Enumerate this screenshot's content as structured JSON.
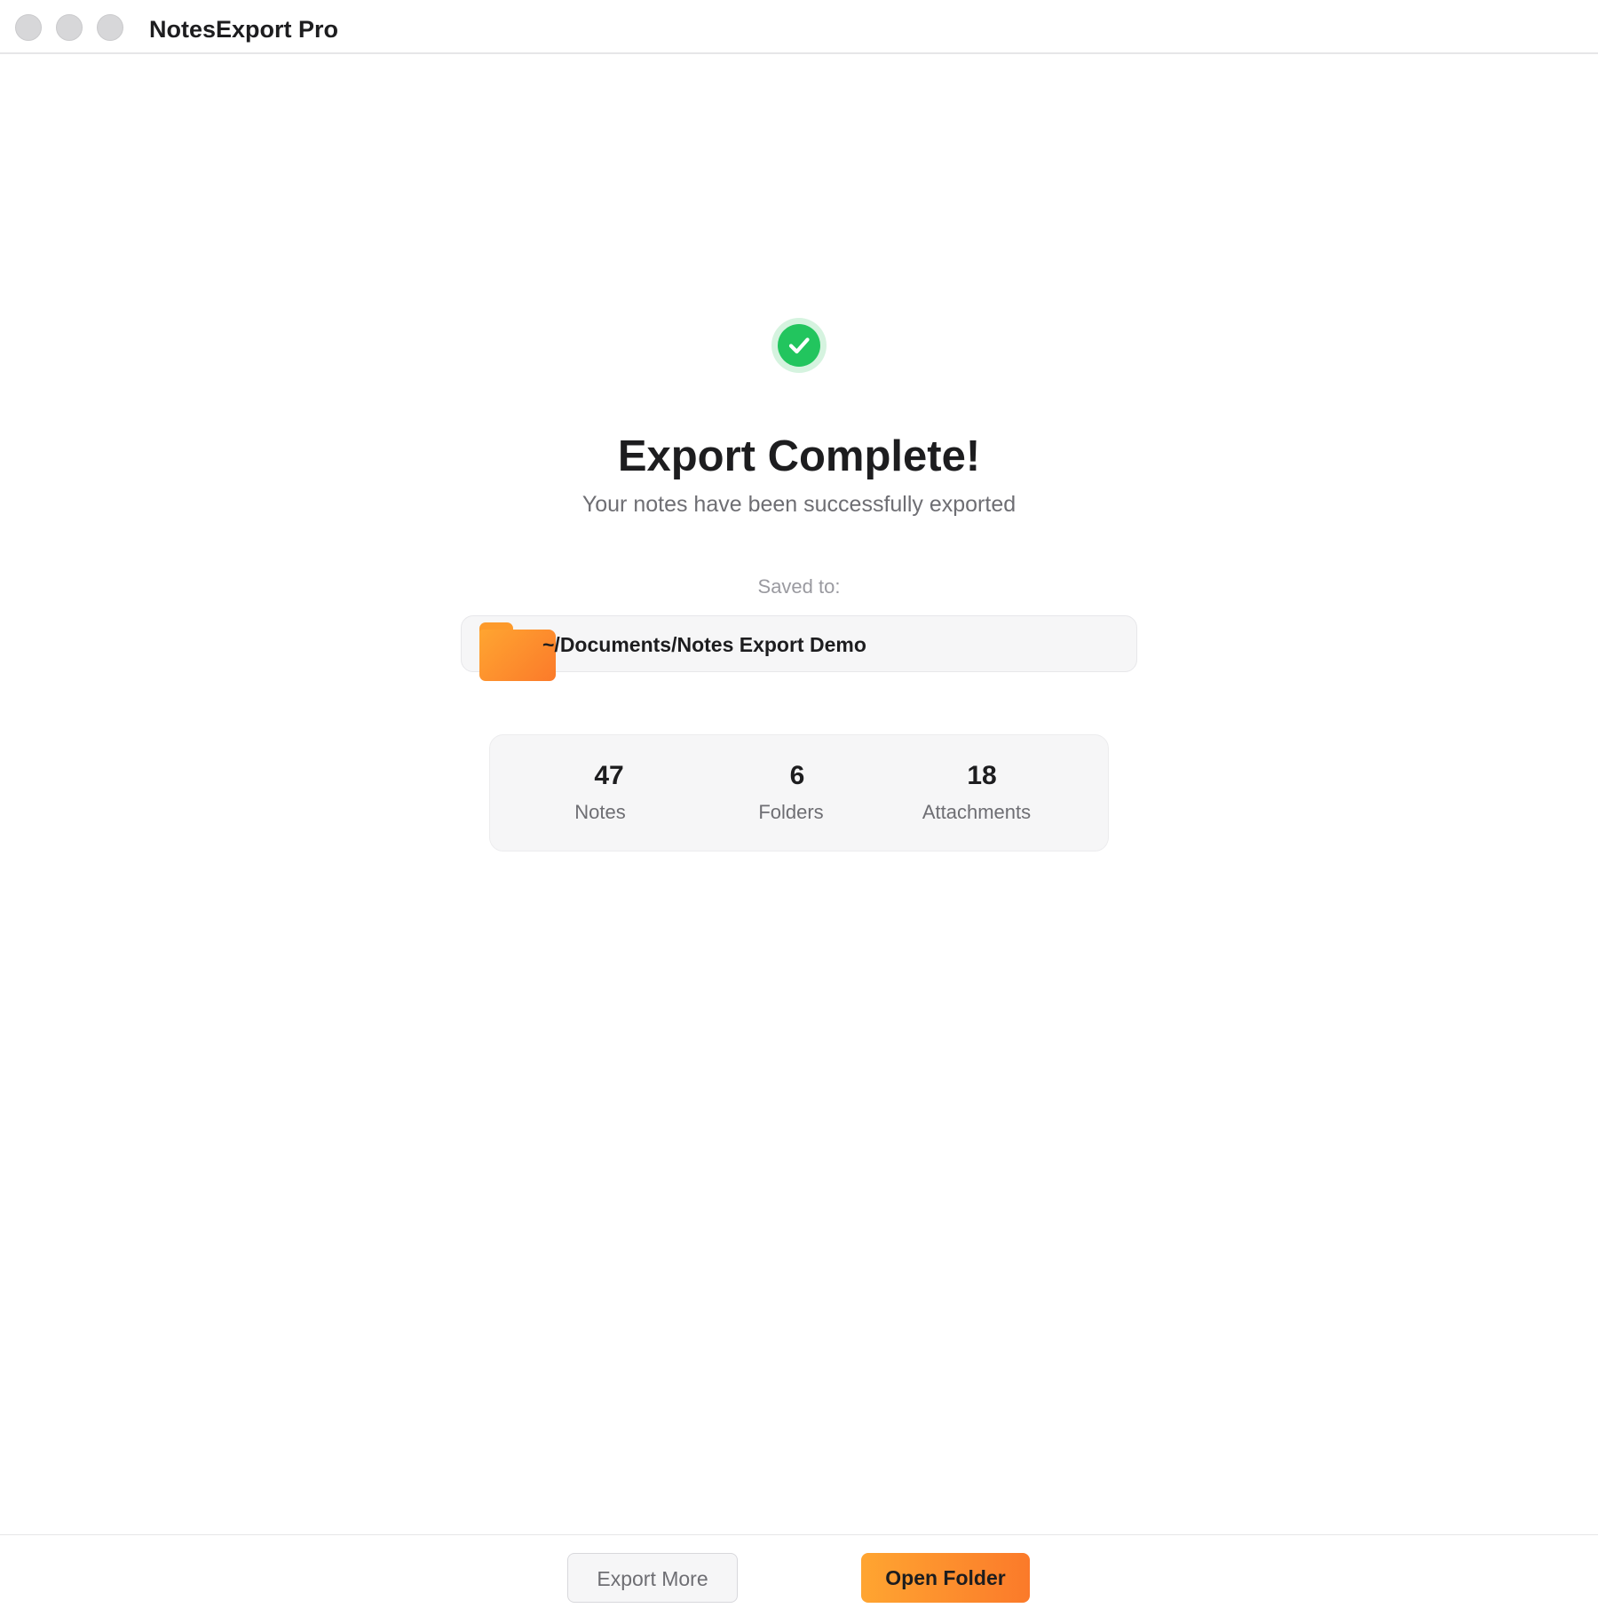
{
  "window": {
    "title": "NotesExport Pro"
  },
  "result": {
    "headline": "Export Complete!",
    "subtitle": "Your notes have been successfully exported",
    "saved_label": "Saved to:",
    "path": "~/Documents/Notes Export Demo"
  },
  "stats": [
    {
      "value": "47",
      "label": "Notes"
    },
    {
      "value": "6",
      "label": "Folders"
    },
    {
      "value": "18",
      "label": "Attachments"
    }
  ],
  "actions": {
    "secondary_label": "Export More",
    "primary_label": "Open Folder"
  },
  "colors": {
    "success": "#22c55e",
    "accent_start": "#ffa531",
    "accent_end": "#fb7a2a"
  },
  "icons": {
    "status": "check-circle-icon",
    "location": "folder-icon"
  }
}
